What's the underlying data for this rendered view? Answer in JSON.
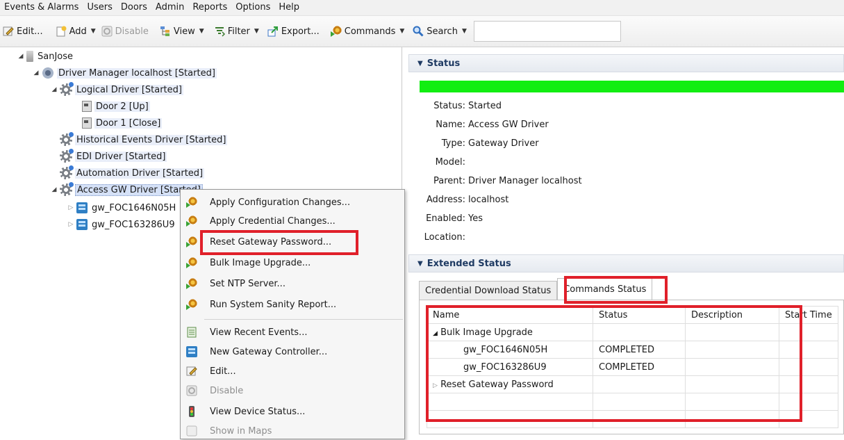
{
  "menu": [
    "Events & Alarms",
    "Users",
    "Doors",
    "Admin",
    "Reports",
    "Options",
    "Help"
  ],
  "toolbar": {
    "edit": "Edit...",
    "add": "Add",
    "disable": "Disable",
    "view": "View",
    "filter": "Filter",
    "export": "Export...",
    "commands": "Commands",
    "search": "Search",
    "search_value": ""
  },
  "tree": {
    "root": "SanJose",
    "driver_manager": "Driver Manager localhost [Started]",
    "logical_driver": "Logical Driver [Started]",
    "door2": "Door 2 [Up]",
    "door1": "Door 1 [Close]",
    "historical": "Historical Events Driver [Started]",
    "edi": "EDI Driver [Started]",
    "automation": "Automation Driver [Started]",
    "access_gw": "Access GW Driver [Started]",
    "gw1": "gw_FOC1646N05H",
    "gw2": "gw_FOC163286U9"
  },
  "context_menu": {
    "items": [
      "Apply Configuration Changes...",
      "Apply Credential Changes...",
      "Reset Gateway Password...",
      "Bulk Image Upgrade...",
      "Set NTP Server...",
      "Run System Sanity Report...",
      "View Recent Events...",
      "New Gateway Controller...",
      "Edit...",
      "Disable",
      "View Device Status...",
      "Show in Maps"
    ]
  },
  "status": {
    "header": "Status",
    "bar_color": "#11ee11",
    "fields": [
      {
        "label": "Status:",
        "value": "Started"
      },
      {
        "label": "Name:",
        "value": "Access GW Driver"
      },
      {
        "label": "Type:",
        "value": "Gateway Driver"
      },
      {
        "label": "Model:",
        "value": ""
      },
      {
        "label": "Parent:",
        "value": "Driver Manager localhost"
      },
      {
        "label": "Address:",
        "value": "localhost"
      },
      {
        "label": "Enabled:",
        "value": "Yes"
      },
      {
        "label": "Location:",
        "value": ""
      }
    ]
  },
  "extended": {
    "header": "Extended Status",
    "tabs": [
      "Credential Download Status",
      "Commands Status"
    ],
    "columns": [
      "Name",
      "Status",
      "Description",
      "Start Time"
    ],
    "rows": [
      {
        "name": "Bulk Image Upgrade",
        "status": "",
        "description": "",
        "start": ""
      },
      {
        "name": "gw_FOC1646N05H",
        "status": "COMPLETED",
        "description": "",
        "start": ""
      },
      {
        "name": "gw_FOC163286U9",
        "status": "COMPLETED",
        "description": "",
        "start": ""
      },
      {
        "name": "Reset Gateway Password",
        "status": "",
        "description": "",
        "start": ""
      }
    ]
  },
  "highlight_color": "#e0202a"
}
